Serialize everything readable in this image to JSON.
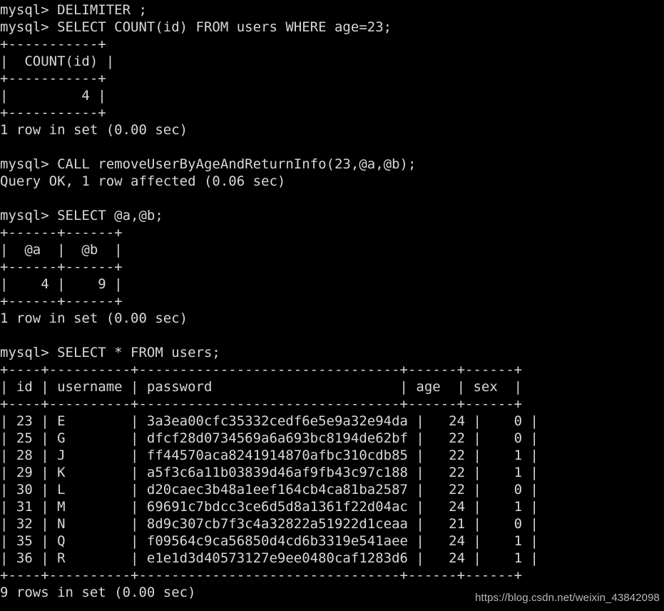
{
  "terminal": {
    "background_color": "#000000",
    "text_color": "#d8d8d8",
    "prompt": "mysql>",
    "blocks": [
      {
        "id": "delimiter-command",
        "command_line": "mysql> DELIMITER ;"
      },
      {
        "id": "count-query",
        "command_line": "mysql> SELECT COUNT(id) FROM users WHERE age=23;",
        "result_table": {
          "rule": "+-----------+",
          "header_row": "|  COUNT(id) |",
          "columns": [
            "COUNT(id)"
          ],
          "rows": [
            [
              "4"
            ]
          ]
        },
        "status_line": "1 row in set (0.00 sec)"
      },
      {
        "id": "call-procedure",
        "command_line": "mysql> CALL removeUserByAgeAndReturnInfo(23,@a,@b);",
        "status_line": "Query OK, 1 row affected (0.06 sec)"
      },
      {
        "id": "select-variables",
        "command_line": "mysql> SELECT @a,@b;",
        "result_table": {
          "rule": "+------+------+",
          "columns": [
            "@a",
            "@b"
          ],
          "rows": [
            [
              "4",
              "9"
            ]
          ]
        },
        "status_line": "1 row in set (0.00 sec)"
      },
      {
        "id": "select-users",
        "command_line": "mysql> SELECT * FROM users;",
        "result_table": {
          "rule": "+----+----------+--------------------------------+------+------+",
          "columns": [
            "id",
            "username",
            "password",
            "age",
            "sex"
          ],
          "rows": [
            [
              "23",
              "E",
              "3a3ea00cfc35332cedf6e5e9a32e94da",
              "24",
              "0"
            ],
            [
              "25",
              "G",
              "dfcf28d0734569a6a693bc8194de62bf",
              "22",
              "0"
            ],
            [
              "28",
              "J",
              "ff44570aca8241914870afbc310cdb85",
              "22",
              "1"
            ],
            [
              "29",
              "K",
              "a5f3c6a11b03839d46af9fb43c97c188",
              "22",
              "1"
            ],
            [
              "30",
              "L",
              "d20caec3b48a1eef164cb4ca81ba2587",
              "22",
              "0"
            ],
            [
              "31",
              "M",
              "69691c7bdcc3ce6d5d8a1361f22d04ac",
              "24",
              "1"
            ],
            [
              "32",
              "N",
              "8d9c307cb7f3c4a32822a51922d1ceaa",
              "21",
              "0"
            ],
            [
              "35",
              "Q",
              "f09564c9ca56850d4cd6b3319e541aee",
              "24",
              "1"
            ],
            [
              "36",
              "R",
              "e1e1d3d40573127e9ee0480caf1283d6",
              "24",
              "1"
            ]
          ]
        },
        "status_line": "9 rows in set (0.00 sec)"
      }
    ],
    "full_text": "mysql> DELIMITER ;\nmysql> SELECT COUNT(id) FROM users WHERE age=23;\n+-----------+\n|  COUNT(id) |\n+-----------+\n|         4 |\n+-----------+\n1 row in set (0.00 sec)\n\nmysql> CALL removeUserByAgeAndReturnInfo(23,@a,@b);\nQuery OK, 1 row affected (0.06 sec)\n\nmysql> SELECT @a,@b;\n+------+------+\n|  @a  |  @b  |\n+------+------+\n|    4 |    9 |\n+------+------+\n1 row in set (0.00 sec)\n\nmysql> SELECT * FROM users;\n+----+----------+--------------------------------+------+------+\n| id | username | password                       | age  | sex  |\n+----+----------+--------------------------------+------+------+\n| 23 | E        | 3a3ea00cfc35332cedf6e5e9a32e94da |   24 |    0 |\n| 25 | G        | dfcf28d0734569a6a693bc8194de62bf |   22 |    0 |\n| 28 | J        | ff44570aca8241914870afbc310cdb85 |   22 |    1 |\n| 29 | K        | a5f3c6a11b03839d46af9fb43c97c188 |   22 |    1 |\n| 30 | L        | d20caec3b48a1eef164cb4ca81ba2587 |   22 |    0 |\n| 31 | M        | 69691c7bdcc3ce6d5d8a1361f22d04ac |   24 |    1 |\n| 32 | N        | 8d9c307cb7f3c4a32822a51922d1ceaa |   21 |    0 |\n| 35 | Q        | f09564c9ca56850d4cd6b3319e541aee |   24 |    1 |\n| 36 | R        | e1e1d3d40573127e9ee0480caf1283d6 |   24 |    1 |\n+----+----------+--------------------------------+------+------+\n9 rows in set (0.00 sec)"
  },
  "watermark": {
    "text": "https://blog.csdn.net/weixin_43842098",
    "color": "#b9b9b9"
  }
}
